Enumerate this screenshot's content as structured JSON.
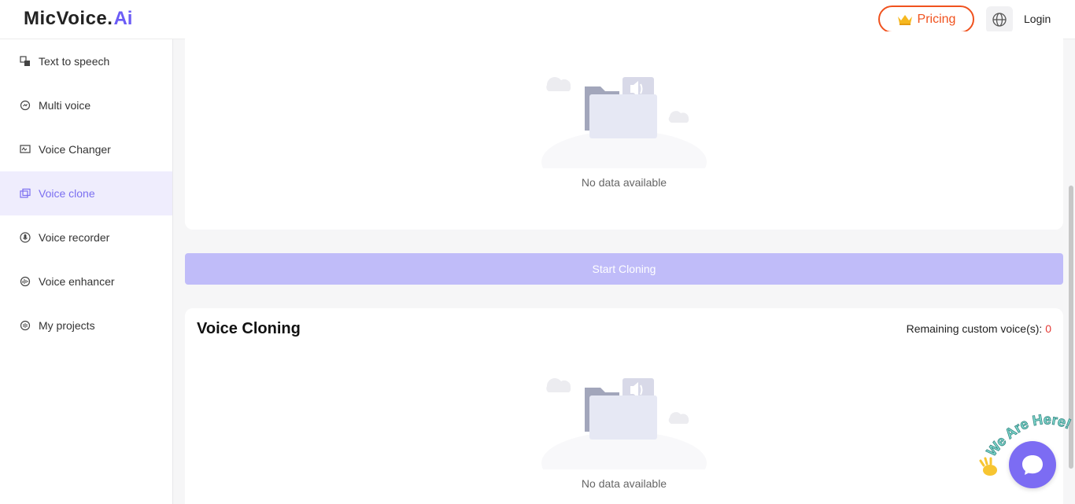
{
  "header": {
    "logo_text": "MicVoice.",
    "logo_ai": "Ai",
    "pricing_label": "Pricing",
    "login_label": "Login"
  },
  "sidebar": {
    "items": [
      {
        "label": "Text to speech",
        "icon": "text-to-speech-icon"
      },
      {
        "label": "Multi voice",
        "icon": "multi-voice-icon"
      },
      {
        "label": "Voice Changer",
        "icon": "voice-changer-icon"
      },
      {
        "label": "Voice clone",
        "icon": "voice-clone-icon",
        "active": true
      },
      {
        "label": "Voice recorder",
        "icon": "microphone-icon"
      },
      {
        "label": "Voice enhancer",
        "icon": "voice-enhancer-icon"
      },
      {
        "label": "My projects",
        "icon": "projects-icon"
      }
    ]
  },
  "main": {
    "top_empty_text": "No data available",
    "start_button_label": "Start Cloning",
    "section_title": "Voice Cloning",
    "remaining_label": "Remaining custom voice(s): ",
    "remaining_count": "0",
    "bottom_empty_text": "No data available"
  },
  "chat": {
    "banner_text": "We Are Here!"
  },
  "colors": {
    "accent": "#7b6ff0",
    "pricing": "#f0521e",
    "start_button": "#c0bcf9",
    "active_bg": "#efedfd",
    "count": "#e53935"
  }
}
